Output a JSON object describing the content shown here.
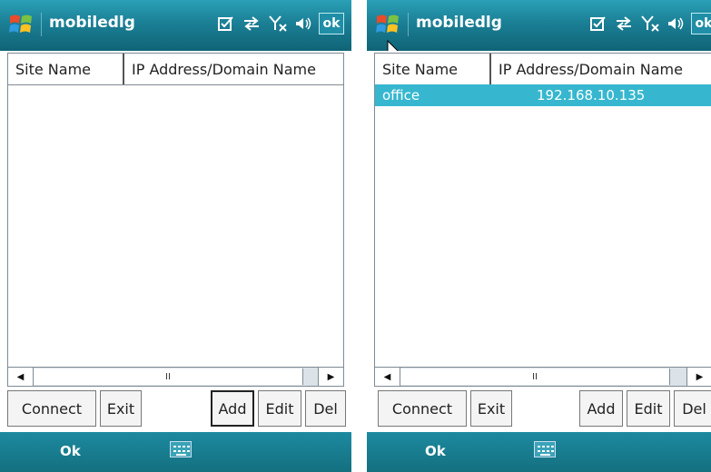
{
  "screens": [
    {
      "title": "mobiledlg",
      "ok_label": "ok",
      "columns": [
        "Site Name",
        "IP Address/Domain Name"
      ],
      "rows": [],
      "scroll_marker": "II",
      "buttons": {
        "connect": "Connect",
        "exit": "Exit",
        "add": "Add",
        "edit": "Edit",
        "del": "Del"
      },
      "focused_button": "add",
      "softkey_left": "Ok"
    },
    {
      "title": "mobiledlg",
      "ok_label": "ok",
      "columns": [
        "Site Name",
        "IP Address/Domain Name"
      ],
      "rows": [
        {
          "site": "office",
          "address": "192.168.10.135",
          "selected": true
        }
      ],
      "scroll_marker": "II",
      "buttons": {
        "connect": "Connect",
        "exit": "Exit",
        "add": "Add",
        "edit": "Edit",
        "del": "Del"
      },
      "focused_button": "none",
      "softkey_left": "Ok"
    }
  ],
  "icons": {
    "start": "windows-start-icon",
    "status": [
      "notification-icon",
      "connectivity-icon",
      "no-signal-icon",
      "volume-icon"
    ],
    "keyboard": "keyboard-icon",
    "pointer": "mouse-pointer-icon"
  },
  "colors": {
    "titlebar": "#1b7f95",
    "selection": "#36b7cf",
    "softbar": "#14707f"
  }
}
